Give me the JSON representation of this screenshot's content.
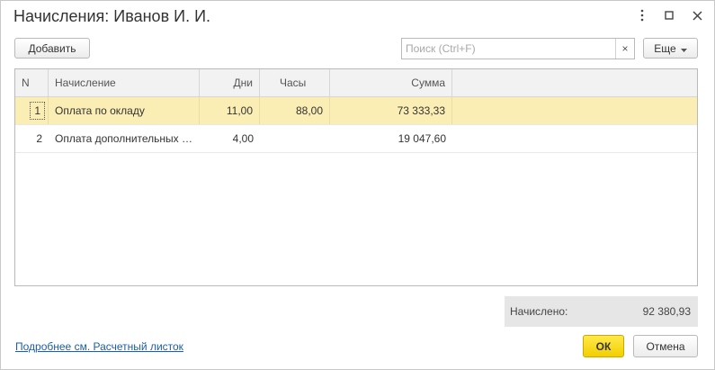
{
  "window": {
    "title": "Начисления: Иванов И. И.",
    "menu_icon": "kebab-menu-icon",
    "maximize_icon": "maximize-icon",
    "close_icon": "close-icon"
  },
  "toolbar": {
    "add_label": "Добавить",
    "search_placeholder": "Поиск (Ctrl+F)",
    "search_clear": "×",
    "more_label": "Еще",
    "more_icon": "caret-down-icon"
  },
  "table": {
    "headers": {
      "n": "N",
      "name": "Начисление",
      "days": "Дни",
      "hours": "Часы",
      "sum": "Сумма"
    },
    "rows": [
      {
        "n": "1",
        "name": "Оплата по окладу",
        "days": "11,00",
        "hours": "88,00",
        "sum": "73 333,33"
      },
      {
        "n": "2",
        "name": "Оплата дополнительных дней отпуска",
        "days": "4,00",
        "hours": "",
        "sum": "19 047,60"
      }
    ]
  },
  "total": {
    "label": "Начислено:",
    "value": "92 380,93"
  },
  "footer": {
    "link": "Подробнее см. Расчетный листок",
    "ok_label": "ОК",
    "cancel_label": "Отмена"
  },
  "colors": {
    "selected_row": "#fbeeb5",
    "ok_button": "#f5d400",
    "link": "#1a5fa8"
  }
}
